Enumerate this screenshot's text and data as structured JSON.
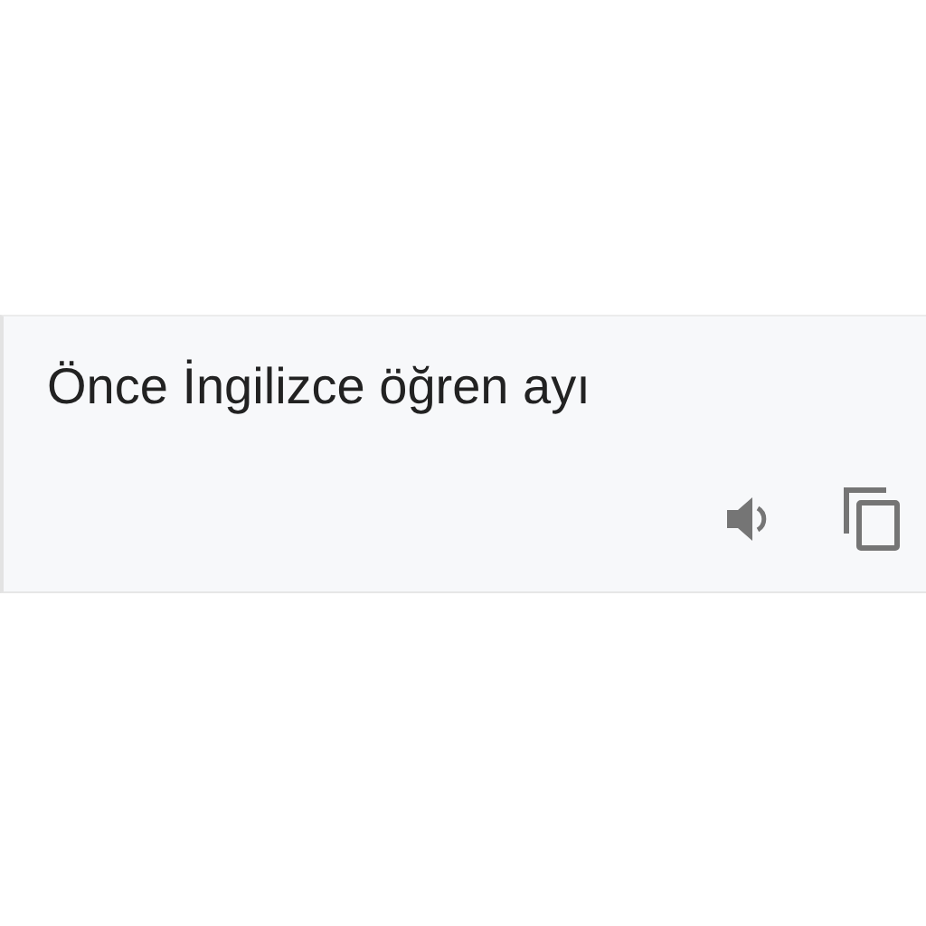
{
  "translation": {
    "text": "Önce İngilizce öğren ayı"
  }
}
